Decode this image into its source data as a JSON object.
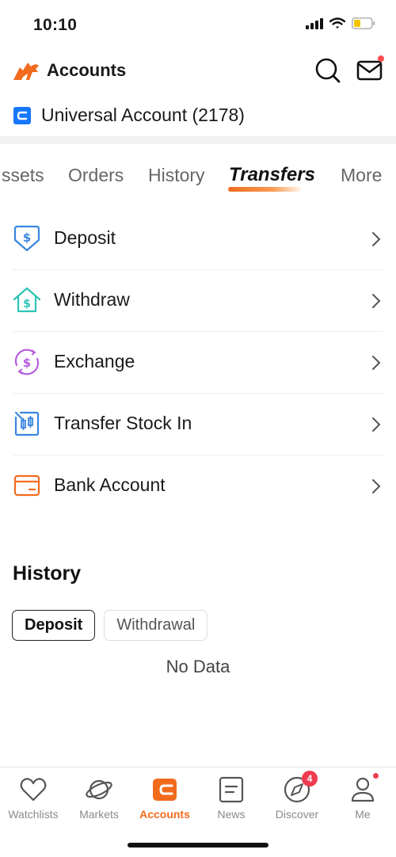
{
  "status_bar": {
    "time": "10:10"
  },
  "header": {
    "title": "Accounts"
  },
  "account": {
    "name": "Universal Account (2178)"
  },
  "tabs": [
    {
      "label": "ssets",
      "active": false
    },
    {
      "label": "Orders",
      "active": false
    },
    {
      "label": "History",
      "active": false
    },
    {
      "label": "Transfers",
      "active": true
    },
    {
      "label": "More",
      "active": false
    }
  ],
  "menu": [
    {
      "label": "Deposit",
      "icon": "deposit-icon",
      "color": "#3a86e0"
    },
    {
      "label": "Withdraw",
      "icon": "withdraw-icon",
      "color": "#2ec4b6"
    },
    {
      "label": "Exchange",
      "icon": "exchange-icon",
      "color": "#b45ce0"
    },
    {
      "label": "Transfer Stock In",
      "icon": "transfer-stock-icon",
      "color": "#3a86e0"
    },
    {
      "label": "Bank Account",
      "icon": "bank-account-icon",
      "color": "#f26b1d"
    }
  ],
  "history": {
    "title": "History",
    "tabs": [
      {
        "label": "Deposit",
        "active": true
      },
      {
        "label": "Withdrawal",
        "active": false
      }
    ],
    "empty_text": "No Data"
  },
  "bottom_nav": [
    {
      "label": "Watchlists",
      "icon": "heart-icon",
      "active": false
    },
    {
      "label": "Markets",
      "icon": "planet-icon",
      "active": false
    },
    {
      "label": "Accounts",
      "icon": "wallet-icon",
      "active": true
    },
    {
      "label": "News",
      "icon": "news-icon",
      "active": false
    },
    {
      "label": "Discover",
      "icon": "compass-icon",
      "active": false,
      "badge": "4"
    },
    {
      "label": "Me",
      "icon": "person-icon",
      "active": false,
      "dot": true
    }
  ],
  "colors": {
    "accent": "#f26b1d",
    "badge": "#ee3b4f",
    "account_icon": "#1677ff"
  }
}
